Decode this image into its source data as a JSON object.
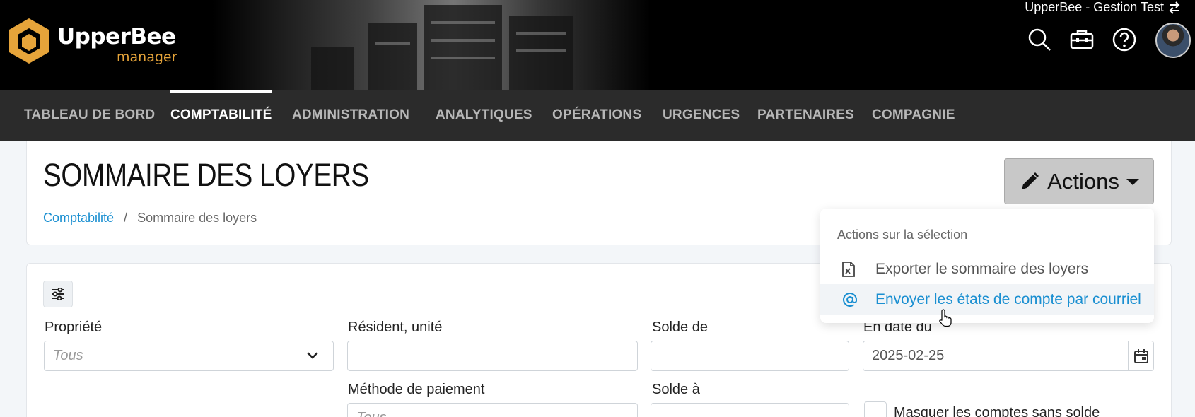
{
  "header": {
    "logo_name": "UpperBee",
    "logo_sub": "manager",
    "company_name": "UpperBee - Gestion Test",
    "icons": [
      "search-icon",
      "toolbox-icon",
      "help-icon",
      "swap-icon"
    ]
  },
  "nav": {
    "items": [
      {
        "label": "TABLEAU DE BORD"
      },
      {
        "label": "COMPTABILITÉ",
        "active": true
      },
      {
        "label": "ADMINISTRATION"
      },
      {
        "label": "ANALYTIQUES"
      },
      {
        "label": "OPÉRATIONS"
      },
      {
        "label": "URGENCES"
      },
      {
        "label": "PARTENAIRES"
      },
      {
        "label": "COMPAGNIE"
      }
    ]
  },
  "page": {
    "title": "SOMMAIRE DES LOYERS",
    "breadcrumb": {
      "parent": "Comptabilité",
      "separator": "/",
      "current": "Sommaire des loyers"
    },
    "actions_label": "Actions"
  },
  "actions_menu": {
    "header": "Actions sur la sélection",
    "items": [
      {
        "label": "Exporter le sommaire des loyers",
        "icon": "excel-file-icon"
      },
      {
        "label": "Envoyer les états de compte par courriel",
        "icon": "at-sign-icon",
        "hovered": true
      }
    ]
  },
  "filters": {
    "propriete": {
      "label": "Propriété",
      "value": "Tous"
    },
    "resident": {
      "label": "Résident, unité",
      "value": ""
    },
    "solde_de": {
      "label": "Solde de",
      "value": ""
    },
    "en_date_du": {
      "label": "En date du",
      "value": "2025-02-25"
    },
    "methode": {
      "label": "Méthode de paiement",
      "value": "Tous"
    },
    "solde_a": {
      "label": "Solde à",
      "value": ""
    },
    "masquer": {
      "label": "Masquer les comptes sans solde",
      "checked": false
    }
  },
  "colors": {
    "accent": "#1a8fd1",
    "brand_orange": "#e6a43a",
    "nav_bg": "#2b2b2b"
  }
}
